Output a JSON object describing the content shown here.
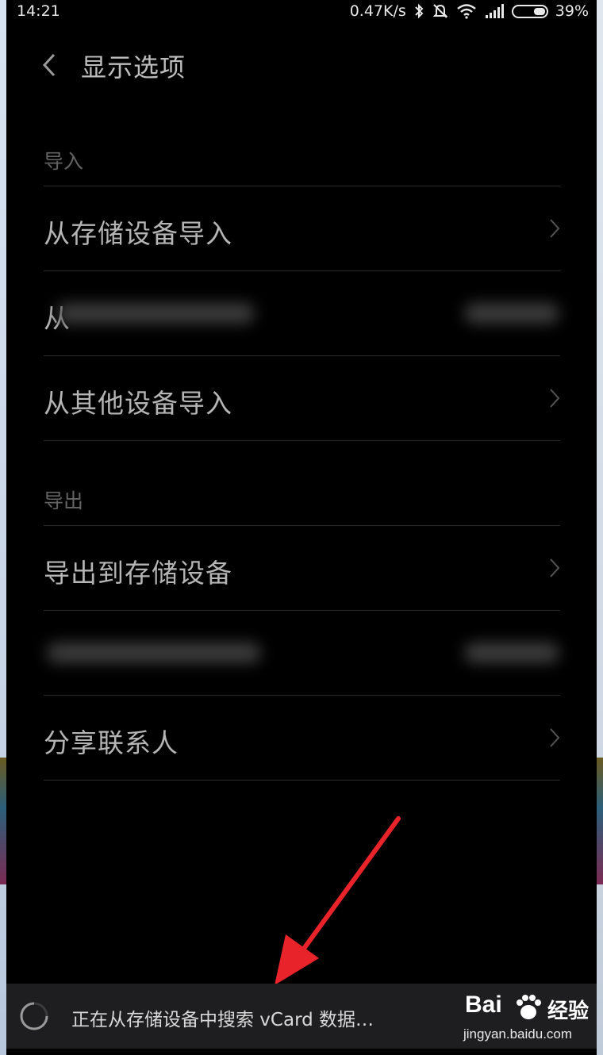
{
  "status_bar": {
    "time": "14:21",
    "speed": "0.47K/s",
    "battery": "39%"
  },
  "header": {
    "title": "显示选项"
  },
  "sections": {
    "import": {
      "title": "导入",
      "items": [
        {
          "label": "从存储设备导入"
        },
        {
          "label": "从"
        },
        {
          "label": "从其他设备导入"
        }
      ]
    },
    "export": {
      "title": "导出",
      "items": [
        {
          "label": "导出到存储设备"
        },
        {
          "label": ""
        },
        {
          "label": "分享联系人"
        }
      ]
    }
  },
  "toast": {
    "message": "正在从存储设备中搜索 vCard 数据…"
  },
  "watermark": {
    "logo": "Bai",
    "logo_suffix": "经验",
    "url": "jingyan.baidu.com"
  },
  "colors": {
    "background": "#000000",
    "text_primary": "#b5b5b5",
    "text_section": "#646464",
    "divider": "#2a2a2a",
    "annotation_arrow": "#e8232a"
  }
}
